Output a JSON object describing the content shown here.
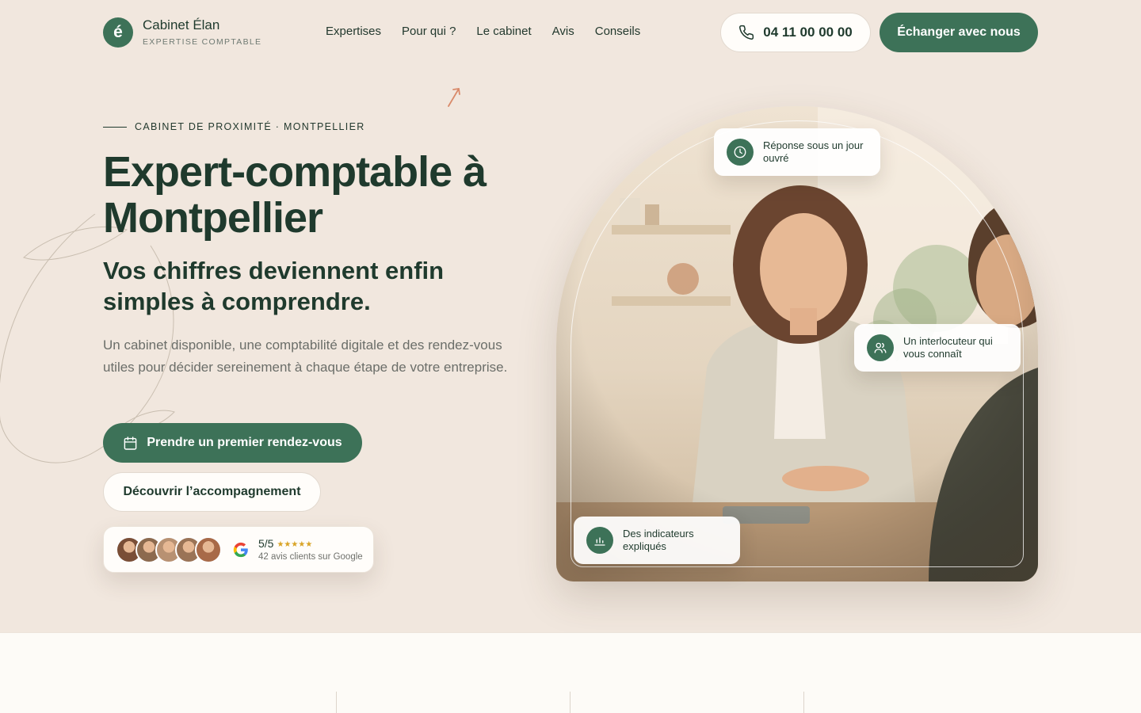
{
  "header": {
    "logo_letter": "é",
    "brand_name": "Cabinet Élan",
    "brand_tagline": "EXPERTISE COMPTABLE",
    "nav": [
      "Expertises",
      "Pour qui ?",
      "Le cabinet",
      "Avis",
      "Conseils"
    ],
    "phone": "04 11 00 00 00",
    "cta": "Échanger avec nous"
  },
  "hero": {
    "eyebrow": "CABINET DE PROXIMITÉ · MONTPELLIER",
    "title_line1": "Expert-comptable à",
    "title_line2": "Montpellier",
    "subtitle_line1": "Vos chiffres deviennent enfin",
    "subtitle_line2": "simples à comprendre.",
    "lead": "Un cabinet disponible, une comptabilité digitale et des rendez-vous utiles pour décider sereinement à chaque étape de votre entreprise.",
    "cta_primary": "Prendre un premier rendez-vous",
    "cta_secondary": "Découvrir l’accompagnement"
  },
  "reviews": {
    "score": "5/5",
    "stars": "★★★★★",
    "count_text": "42 avis clients sur Google",
    "avatar_colors": [
      "#7a4e36",
      "#8c6a4e",
      "#b89172",
      "#9a7356",
      "#a86a48"
    ]
  },
  "photo_badges": [
    {
      "text": "Réponse sous un jour ouvré",
      "icon": "clock-icon"
    },
    {
      "text": "Un interlocuteur qui vous connaît",
      "icon": "users-icon"
    },
    {
      "text": "Des indicateurs expliqués",
      "icon": "bar-chart-icon"
    }
  ],
  "colors": {
    "brand_green": "#3d7258",
    "hero_background": "#f1e7de",
    "heading": "#1f3a2d",
    "body_text": "#6b6e69",
    "star": "#d9a426",
    "accent_arrow": "#d98a6a"
  }
}
